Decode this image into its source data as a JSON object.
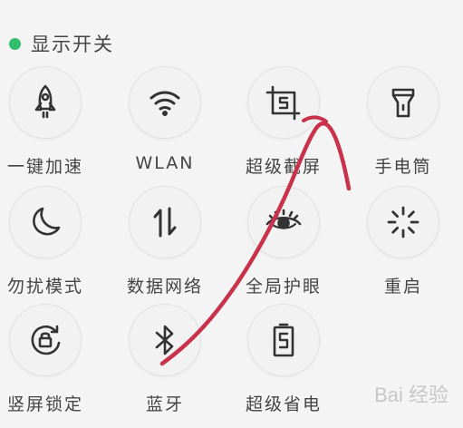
{
  "header": {
    "title": "显示开关",
    "accent": "#2fbf6a"
  },
  "tiles": [
    {
      "label": "一键加速",
      "icon": "rocket-icon"
    },
    {
      "label": "WLAN",
      "icon": "wifi-icon"
    },
    {
      "label": "超级截屏",
      "icon": "screenshot-icon"
    },
    {
      "label": "手电筒",
      "icon": "flashlight-icon"
    },
    {
      "label": "勿扰模式",
      "icon": "moon-icon"
    },
    {
      "label": "数据网络",
      "icon": "mobile-data-icon"
    },
    {
      "label": "全局护眼",
      "icon": "eye-icon"
    },
    {
      "label": "重启",
      "icon": "restart-icon"
    },
    {
      "label": "竖屏锁定",
      "icon": "rotation-lock-icon"
    },
    {
      "label": "蓝牙",
      "icon": "bluetooth-icon"
    },
    {
      "label": "超级省电",
      "icon": "battery-saver-icon"
    }
  ],
  "annotation": {
    "color": "#c8324a"
  },
  "watermark": "Bai 经验"
}
